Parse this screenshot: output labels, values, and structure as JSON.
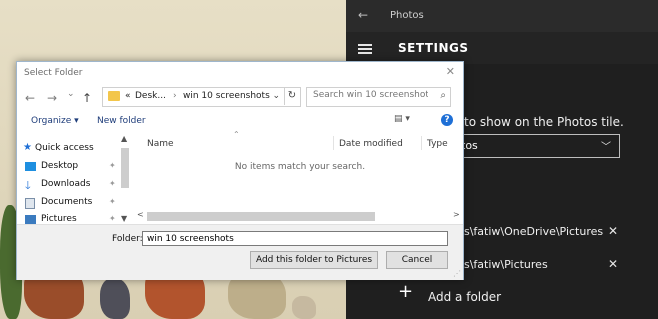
{
  "photos": {
    "app_title": "Photos",
    "back_icon": "←",
    "settings_title": "SETTINGS",
    "tile_text": "to show on the Photos tile.",
    "tile_dropdown_value": "tos",
    "folders": [
      {
        "path": "s\\fatiw\\OneDrive\\Pictures",
        "remove": "✕"
      },
      {
        "path": "s\\fatiw\\Pictures",
        "remove": "✕"
      }
    ],
    "add_folder_icon": "+",
    "add_folder_label": "Add a folder"
  },
  "dialog": {
    "title": "Select Folder",
    "close": "✕",
    "nav": {
      "back": "←",
      "forward": "→",
      "recent": "⌄",
      "up": "↑"
    },
    "address": {
      "prefix": "«",
      "crumb1": "Desk...",
      "separator": "›",
      "crumb2": "win 10 screenshots",
      "chevron": "⌄",
      "refresh": "↻"
    },
    "search": {
      "placeholder": "Search win 10 screenshots",
      "icon": "⌕"
    },
    "toolbar": {
      "organize": "Organize ▾",
      "new_folder": "New folder",
      "view": "▤ ▾",
      "help": "?"
    },
    "nav_pane": [
      {
        "label": "Quick access",
        "icon": "star-icon"
      },
      {
        "label": "Desktop",
        "icon": "desktop-icon"
      },
      {
        "label": "Downloads",
        "icon": "download-icon"
      },
      {
        "label": "Documents",
        "icon": "documents-icon"
      },
      {
        "label": "Pictures",
        "icon": "pictures-icon"
      }
    ],
    "pin": "📌",
    "columns": {
      "name": "Name",
      "date_modified": "Date modified",
      "type": "Type",
      "sort": "⌃"
    },
    "empty_message": "No items match your search.",
    "scroll": {
      "up": "▲",
      "down": "▼",
      "left": "<",
      "right": ">"
    },
    "folder_label": "Folder:",
    "folder_value": "win 10 screenshots",
    "buttons": {
      "add": "Add this folder to Pictures",
      "cancel": "Cancel"
    }
  }
}
